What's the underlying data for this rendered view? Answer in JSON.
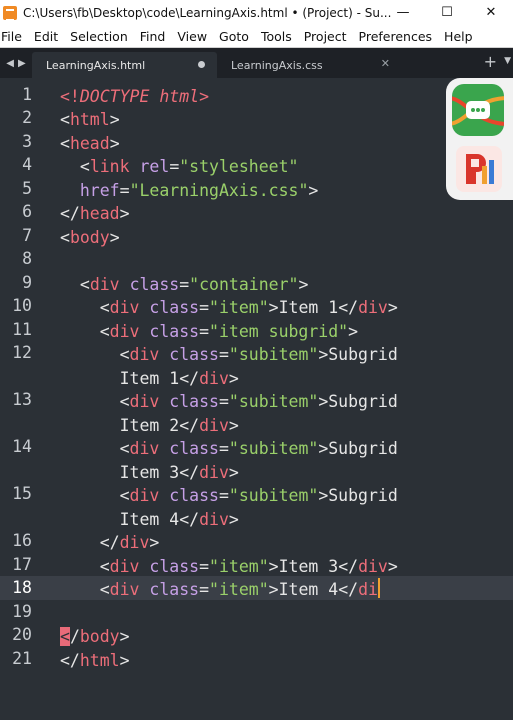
{
  "window": {
    "title": "C:\\Users\\fb\\Desktop\\code\\LearningAxis.html • (Project) - Su...",
    "minimize": "—",
    "maximize": "☐",
    "close": "✕"
  },
  "menu": [
    "File",
    "Edit",
    "Selection",
    "Find",
    "View",
    "Goto",
    "Tools",
    "Project",
    "Preferences",
    "Help"
  ],
  "tabs": [
    {
      "label": "LearningAxis.html",
      "active": true,
      "dirty": true
    },
    {
      "label": "LearningAxis.css",
      "active": false,
      "close": "✕"
    }
  ],
  "tabbar": {
    "prev": "◀",
    "next": "▶",
    "new_tab": "+",
    "menu": "▼"
  },
  "editor": {
    "line_numbers": [
      "1",
      "2",
      "3",
      "4",
      "5",
      "6",
      "7",
      "8",
      "9",
      "10",
      "11",
      "12",
      "13",
      "14",
      "15",
      "16",
      "17",
      "18",
      "19",
      "20",
      "21"
    ],
    "current_line": "18",
    "lines": {
      "l1a": "<!",
      "l1b": "DOCTYPE",
      "l1c": " ",
      "l1d": "html",
      "l1e": ">",
      "l2a": "<",
      "l2b": "html",
      "l2c": ">",
      "l3a": "<",
      "l3b": "head",
      "l3c": ">",
      "l4a": "  <",
      "l4b": "link",
      "l4c": " ",
      "l4d": "rel",
      "l4e": "=",
      "l4f": "\"stylesheet\"",
      "l5a": "  ",
      "l5b": "href",
      "l5c": "=",
      "l5d": "\"LearningAxis.css\"",
      "l5e": ">",
      "l6a": "</",
      "l6b": "head",
      "l6c": ">",
      "l7a": "<",
      "l7b": "body",
      "l7c": ">",
      "l9a": "  <",
      "l9b": "div",
      "l9c": " ",
      "l9d": "class",
      "l9e": "=",
      "l9f": "\"container\"",
      "l9g": ">",
      "l10a": "    <",
      "l10b": "div",
      "l10c": " ",
      "l10d": "class",
      "l10e": "=",
      "l10f": "\"item\"",
      "l10g": ">",
      "l10h": "Item 1",
      "l10i": "</",
      "l10j": "div",
      "l10k": ">",
      "l11a": "    <",
      "l11b": "div",
      "l11c": " ",
      "l11d": "class",
      "l11e": "=",
      "l11f": "\"item subgrid\"",
      "l11g": ">",
      "l12a": "      <",
      "l12b": "div",
      "l12c": " ",
      "l12d": "class",
      "l12e": "=",
      "l12f": "\"subitem\"",
      "l12g": ">",
      "l12h": "Subgrid",
      "l12w1": "      Item 1",
      "l12w2": "</",
      "l12w3": "div",
      "l12w4": ">",
      "l13a": "      <",
      "l13b": "div",
      "l13c": " ",
      "l13d": "class",
      "l13e": "=",
      "l13f": "\"subitem\"",
      "l13g": ">",
      "l13h": "Subgrid",
      "l13w1": "      Item 2",
      "l13w2": "</",
      "l13w3": "div",
      "l13w4": ">",
      "l14a": "      <",
      "l14b": "div",
      "l14c": " ",
      "l14d": "class",
      "l14e": "=",
      "l14f": "\"subitem\"",
      "l14g": ">",
      "l14h": "Subgrid",
      "l14w1": "      Item 3",
      "l14w2": "</",
      "l14w3": "div",
      "l14w4": ">",
      "l15a": "      <",
      "l15b": "div",
      "l15c": " ",
      "l15d": "class",
      "l15e": "=",
      "l15f": "\"subitem\"",
      "l15g": ">",
      "l15h": "Subgrid",
      "l15w1": "      Item 4",
      "l15w2": "</",
      "l15w3": "div",
      "l15w4": ">",
      "l16a": "    </",
      "l16b": "div",
      "l16c": ">",
      "l17a": "    <",
      "l17b": "div",
      "l17c": " ",
      "l17d": "class",
      "l17e": "=",
      "l17f": "\"item\"",
      "l17g": ">",
      "l17h": "Item 3",
      "l17i": "</",
      "l17j": "div",
      "l17k": ">",
      "l18a": "    <",
      "l18b": "div",
      "l18c": " ",
      "l18d": "class",
      "l18e": "=",
      "l18f": "\"item\"",
      "l18g": ">",
      "l18h": "Item 4",
      "l18i": "</",
      "l18j": "di",
      "l20a": "<",
      "l20b": "/",
      "l20c": "body",
      "l20d": ">",
      "l21a": "</",
      "l21b": "html",
      "l21c": ">"
    }
  },
  "colors": {
    "background": "#2b3036",
    "tag": "#ed6e7a",
    "attribute": "#c6a0e6",
    "string": "#9ad06a",
    "caret": "#f0a030"
  }
}
